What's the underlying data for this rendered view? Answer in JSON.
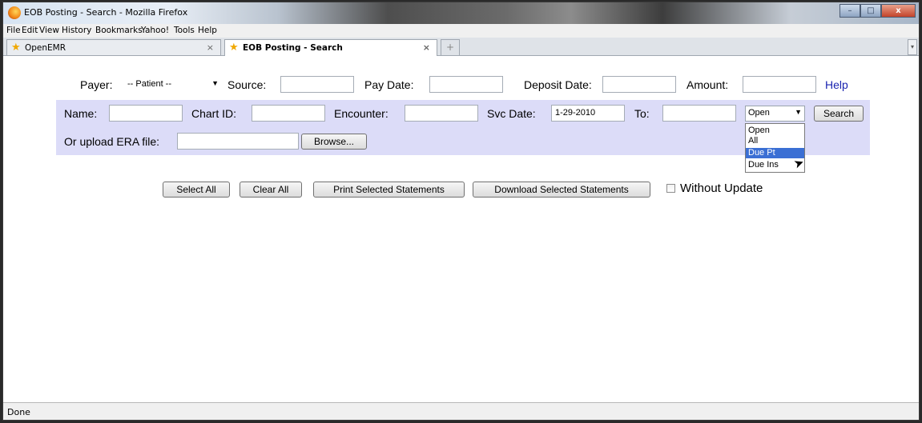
{
  "window": {
    "title": "EOB Posting - Search - Mozilla Firefox",
    "controls": {
      "minimize": "–",
      "maximize": "□",
      "close": "x"
    }
  },
  "menu": [
    "File",
    "Edit",
    "View",
    "History",
    "Bookmarks",
    "Yahoo!",
    "Tools",
    "Help"
  ],
  "tabs": [
    {
      "label": "OpenEMR",
      "close": "×"
    },
    {
      "label": "EOB Posting - Search",
      "close": "×"
    }
  ],
  "new_tab": "+",
  "tab_scroll": "▾",
  "form": {
    "payer_label": "Payer:",
    "payer_value": "-- Patient --",
    "source_label": "Source:",
    "paydate_label": "Pay Date:",
    "deposit_label": "Deposit Date:",
    "amount_label": "Amount:",
    "help": "Help",
    "name_label": "Name:",
    "chartid_label": "Chart ID:",
    "encounter_label": "Encounter:",
    "svcdate_label": "Svc Date:",
    "svcdate_value": "1-29-2010",
    "to_label": "To:",
    "status_value": "Open",
    "status_options": [
      "Open",
      "All",
      "Due Pt",
      "Due Ins"
    ],
    "status_highlighted": "Due Pt",
    "search_button": "Search",
    "era_label": "Or upload ERA file:",
    "browse_button": "Browse..."
  },
  "actions": {
    "select_all": "Select All",
    "clear_all": "Clear All",
    "print_selected": "Print Selected Statements",
    "download_selected": "Download Selected Statements",
    "without_update": "Without Update"
  },
  "status": "Done",
  "colors": {
    "band": "#dcdcf8",
    "help_link": "#1a24b0",
    "highlight": "#3b6fd4"
  }
}
